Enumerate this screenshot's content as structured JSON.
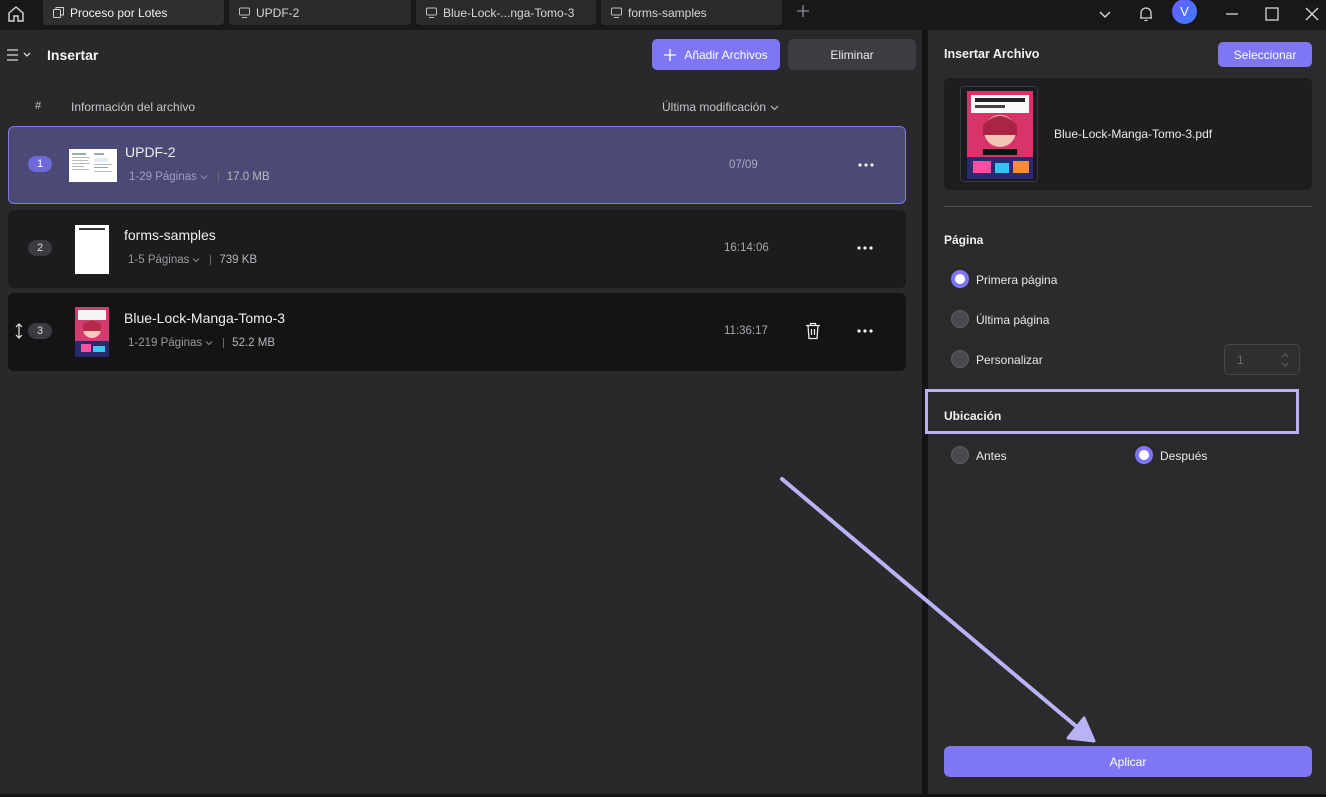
{
  "titlebar": {
    "tabs": [
      {
        "label": "Proceso por Lotes",
        "icon": "batch-icon"
      },
      {
        "label": "UPDF-2",
        "icon": "document-tab-icon"
      },
      {
        "label": "Blue-Lock-...nga-Tomo-3",
        "icon": "document-tab-icon"
      },
      {
        "label": "forms-samples",
        "icon": "document-tab-icon"
      }
    ],
    "avatar_initial": "V",
    "icons": [
      "home-icon",
      "plus-icon",
      "chevron-down-icon",
      "bell-icon",
      "minimize-icon",
      "maximize-icon",
      "close-icon"
    ]
  },
  "left": {
    "title": "Insertar",
    "add_button": "Añadir Archivos",
    "delete_button": "Eliminar",
    "columns": {
      "num": "#",
      "info": "Información del archivo",
      "modified": "Última modificación"
    },
    "files": [
      {
        "num": "1",
        "name": "UPDF-2",
        "pages": "1-29 Páginas",
        "size": "17.0 MB",
        "date": "07/09"
      },
      {
        "num": "2",
        "name": "forms-samples",
        "pages": "1-5 Páginas",
        "size": "739 KB",
        "date": "16:14:06"
      },
      {
        "num": "3",
        "name": "Blue-Lock-Manga-Tomo-3",
        "pages": "1-219 Páginas",
        "size": "52.2 MB",
        "date": "11:36:17"
      }
    ]
  },
  "right": {
    "title": "Insertar Archivo",
    "select_button": "Seleccionar",
    "file_name": "Blue-Lock-Manga-Tomo-3.pdf",
    "page_section": "Página",
    "page_options": [
      "Primera página",
      "Última página",
      "Personalizar"
    ],
    "custom_page_value": "1",
    "location_section": "Ubicación",
    "location_options": [
      "Antes",
      "Después"
    ],
    "apply_button": "Aplicar"
  },
  "colors": {
    "accent": "#7e76f2",
    "annotation": "#b9b3f5"
  }
}
